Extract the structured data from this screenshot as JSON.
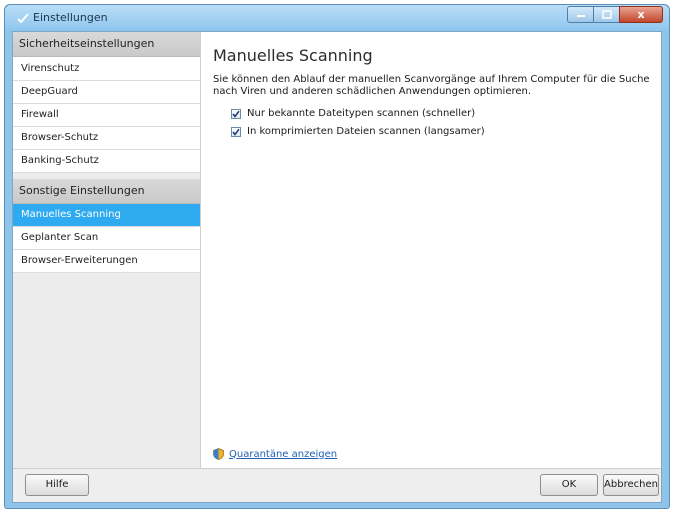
{
  "window": {
    "title": "Einstellungen",
    "close_glyph": "x"
  },
  "sidebar": {
    "groups": [
      {
        "header": "Sicherheitseinstellungen",
        "items": [
          {
            "label": "Virenschutz"
          },
          {
            "label": "DeepGuard"
          },
          {
            "label": "Firewall"
          },
          {
            "label": "Browser-Schutz"
          },
          {
            "label": "Banking-Schutz"
          }
        ]
      },
      {
        "header": "Sonstige Einstellungen",
        "items": [
          {
            "label": "Manuelles Scanning",
            "active": true
          },
          {
            "label": "Geplanter Scan"
          },
          {
            "label": "Browser-Erweiterungen"
          }
        ]
      }
    ]
  },
  "main": {
    "title": "Manuelles Scanning",
    "description": "Sie können den Ablauf der manuellen Scanvorgänge auf Ihrem Computer für die Suche nach Viren und anderen schädlichen Anwendungen optimieren.",
    "options": [
      {
        "label": "Nur bekannte Dateitypen scannen (schneller)",
        "checked": true
      },
      {
        "label": "In komprimierten Dateien scannen (langsamer)",
        "checked": true
      }
    ],
    "quarantine_link": "Quarantäne anzeigen"
  },
  "footer": {
    "help": "Hilfe",
    "ok": "OK",
    "cancel": "Abbrechen"
  },
  "colors": {
    "accent": "#2eaaf0",
    "link": "#1f5fb3",
    "titlebar": "#8ec6ee"
  },
  "icons": {
    "app": "app-check-icon",
    "checkbox": "checkmark-icon",
    "quarantine": "shield-icon"
  }
}
